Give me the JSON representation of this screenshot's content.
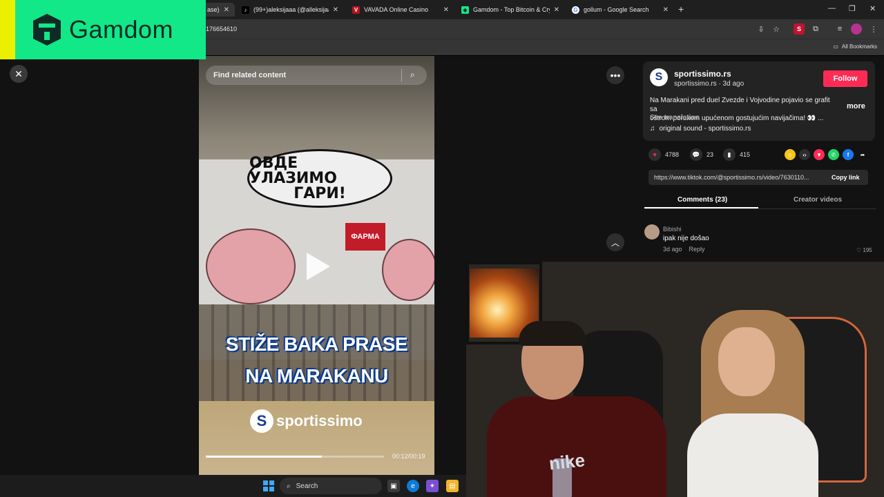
{
  "browser": {
    "tabs": [
      {
        "title": "ase) |",
        "favicon": "partial",
        "active": true
      },
      {
        "title": "(99+)aleksijaaa (@alleksijaaaa) |",
        "favicon": "tiktok-icon"
      },
      {
        "title": "VAVADA Online Casino",
        "favicon": "vavada-icon"
      },
      {
        "title": "Gamdom - Top Bitcoin & Crypt",
        "favicon": "gamdom-icon"
      },
      {
        "title": "gollum - Google Search",
        "favicon": "google-icon"
      }
    ],
    "url": "176654610",
    "bookmarks_label": "All Bookmarks"
  },
  "overlay": {
    "brand_name": "Gamdom",
    "brand_color": "#12e888",
    "accent_color": "#eaf000"
  },
  "video": {
    "search_placeholder": "Find related content",
    "bubble_line1": "ОВДЕ УЛАЗИМО",
    "bubble_line2": "ГАРИ!",
    "sign_text": "ФАРМА",
    "caption_line1": "STIŽE BAKA PRASE",
    "caption_line2": "NA MARAKANU",
    "watermark": "sportissimo",
    "time": "00:12/00:19",
    "progress": 0.65
  },
  "post": {
    "username": "sportissimo.rs",
    "subline": "sportissimo.rs · 3d ago",
    "follow_label": "Follow",
    "description_line1": "Na Marakani pred duel Zvezde i Vojvodine pojavio se grafit sa",
    "description_line2": "oštrom porukom upućenom gostujućim navijačima! 👀 ...",
    "more_label": "more",
    "see_translation": "See translation",
    "sound": "original sound - sportissimo.rs",
    "likes": "4788",
    "comments": "23",
    "saves": "415",
    "link": "https://www.tiktok.com/@sportissimo.rs/video/7630110...",
    "copy_label": "Copy link",
    "tab_comments": "Comments (23)",
    "tab_creator": "Creator videos",
    "accent_color": "#fe2c55"
  },
  "comment": {
    "author": "Bibishi",
    "text": "ipak nije došao",
    "time": "3d ago",
    "reply_label": "Reply",
    "likes": "195"
  },
  "webcam": {
    "shirt_text": "nike"
  },
  "taskbar": {
    "search_label": "Search"
  }
}
